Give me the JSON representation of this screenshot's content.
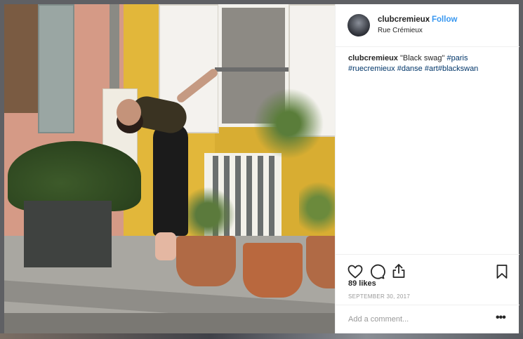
{
  "post": {
    "username": "clubcremieux",
    "separator": "•",
    "follow_label": "Follow",
    "location": "Rue Crémieux",
    "caption": {
      "username": "clubcremieux",
      "text": " \"Black swag\" ",
      "hashtags": [
        "#paris",
        "#ruecremieux",
        "#danse",
        "#art",
        "#blackswan"
      ]
    },
    "likes": "89 likes",
    "date": "SEPTEMBER 30, 2017",
    "comment_placeholder": "Add a comment...",
    "more_label": "•••"
  },
  "icons": {
    "like": "heart-icon",
    "comment": "comment-icon",
    "share": "share-icon",
    "save": "bookmark-icon"
  },
  "colors": {
    "link_blue": "#3897f0",
    "hashtag": "#003569",
    "text": "#262626",
    "muted": "#999999"
  }
}
